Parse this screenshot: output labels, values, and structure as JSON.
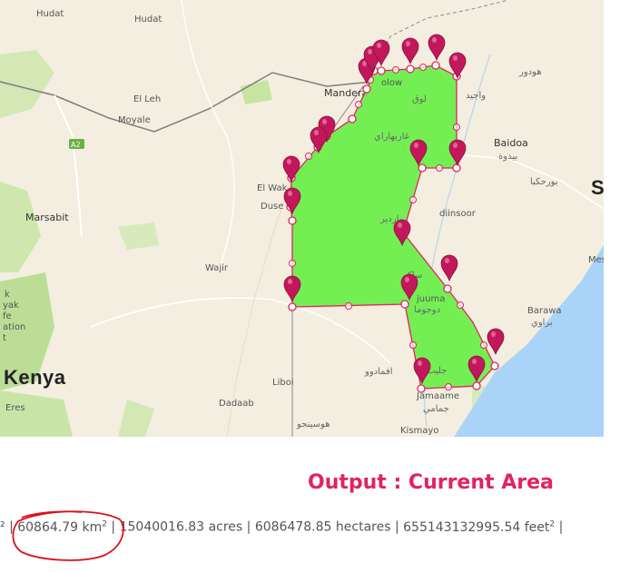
{
  "map": {
    "labels": {
      "hudat": "Hudat",
      "mandera": "Mandera",
      "el_leh": "El Leh",
      "moyale": "Moyale",
      "a2": "A2",
      "el_wak": "El Wak",
      "duse": "Duse",
      "marsabit": "Marsabit",
      "wajir": "Wajir",
      "kenya": "Kenya",
      "baidoa": "Baidoa",
      "baidoa_ar": "بيدوة",
      "diinsoor": "diinsoor",
      "barawa": "Barawa",
      "barawa_ar": "براوي",
      "liboi": "Liboi",
      "dadaab": "Dadaab",
      "jamaame": "Jamaame",
      "jamaame_ar": "جمامي",
      "kismayo": "Kismayo",
      "eres": "Eres",
      "luuq_ar": "لوق",
      "wajid_ar": "واجيد",
      "hoddur_ar": "هودور",
      "burhakaba_ar": "بورحكبا",
      "garbahaarrey_ar": "غاربهاراي",
      "bardhere_ar": "باردير",
      "saakow_ar": "ساكو",
      "dujuuma_ar": "دوجوما",
      "afmadow_ar": "افمادوو",
      "jilib_ar": "جليب",
      "hosingo_ar": "هوسينجو",
      "partial_k": "k",
      "partial_yak": "yak",
      "partial_fe": "fe",
      "partial_ation": "ation",
      "partial_t": "t",
      "partial_mes": "Mes",
      "partial_s": "S",
      "olow": "olow",
      "dujuuma_partial": "juuma"
    },
    "colors": {
      "polygon_fill": "#66ee44",
      "polygon_stroke": "#e0245e",
      "marker": "#c2185b",
      "land": "#f3eedf",
      "ocean": "#a9d4f7",
      "green": "#c9e5a6"
    }
  },
  "output": {
    "title": "Output : Current Area",
    "lead": "² | ",
    "km2_value": "60864.79 km",
    "km2_sup": "2",
    "sep1": " | ",
    "acres": "15040016.83 acres",
    "sep2": " | ",
    "hectares": "6086478.85 hectares",
    "sep3": " | ",
    "feet_value": "655143132995.54 feet",
    "feet_sup": "2",
    "tail": " |"
  }
}
